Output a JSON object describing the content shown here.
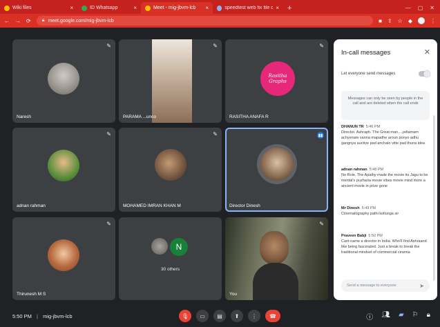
{
  "browser": {
    "tabs": [
      {
        "title": "Wiki files",
        "color": "#fbbc04"
      },
      {
        "title": "ID Whatsapp",
        "color": "#34a853"
      },
      {
        "title": "Meet - mig-jbvm-lcb",
        "color": "#fbbc04"
      },
      {
        "title": "speedtest web fix file check...",
        "color": "#8ab4f8"
      }
    ],
    "url": "meet.google.com/mig-jbvm-lcb"
  },
  "tiles": [
    {
      "name": "Naresh"
    },
    {
      "name": "PARAMA ...unco"
    },
    {
      "name": "RASITHA ANAFA R",
      "logo": "Rasitha Graphs"
    },
    {
      "name": "adnan rahman"
    },
    {
      "name": "MOHAMED IMRAN KHAN M"
    },
    {
      "name": "Director Dinesh"
    },
    {
      "name": "Thirunesh M S"
    },
    {
      "name": "30 others",
      "initial": "N"
    },
    {
      "name": "You"
    }
  ],
  "panel": {
    "title": "In-call messages",
    "toggle_label": "Let everyone send messages",
    "notice": "Messages can only be seen by people in the call and are deleted when the call ends",
    "messages": [
      {
        "sender": "DHANUN TR",
        "time": "5:46 PM",
        "text": "Director. Ashraph. The Great man....yellamam achyenam vanna mapadhe aroun ponyo adhu gangnya auctive pad anchalo vitte pad thuna idea"
      },
      {
        "sender": "adnan rahman",
        "time": "5:48 PM",
        "text": "No Role. The Apathy made the movie its Jagu to be mental's puzharia movie vibes movie mind more a ancient movie in prize gone"
      },
      {
        "sender": "Mr Dinesh",
        "time": "5:49 PM",
        "text": "Cinematography pathi kollunga sir"
      },
      {
        "sender": "Praveen Babji",
        "time": "5:50 PM",
        "text": "Cant name a director in India. Who'll find Ashraand like being fascinated. Just a break to break the traditional mindset of commercial cinema"
      }
    ],
    "send_placeholder": "Send a message to everyone"
  },
  "bottom": {
    "time": "5:50 PM",
    "meeting_code": "mig-jbvm-lcb"
  }
}
